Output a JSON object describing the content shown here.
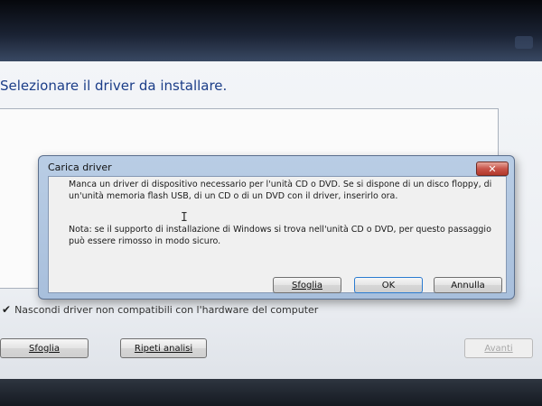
{
  "wizard": {
    "title": "Selezionare il driver da installare.",
    "hide_incompatible_label": "Nascondi driver non compatibili con l'hardware del computer",
    "hide_incompatible_checked": true,
    "buttons": {
      "browse": "Sfoglia",
      "rescan": "Ripeti analisi",
      "next": "Avanti"
    }
  },
  "dialog": {
    "title": "Carica driver",
    "close_glyph": "✕",
    "message": "Manca un driver di dispositivo necessario per l'unità CD o DVD. Se si dispone di un disco floppy, di un'unità memoria flash USB, di un CD o di un DVD con il driver, inserirlo ora.",
    "note": "Nota: se il supporto di installazione di Windows si trova nell'unità CD o DVD, per questo passaggio può essere rimosso in modo sicuro.",
    "buttons": {
      "browse": "Sfoglia",
      "ok": "OK",
      "cancel": "Annulla"
    }
  },
  "colors": {
    "title_blue": "#1b3d88",
    "dialog_frame": "#b9cde5",
    "close_red": "#c8554a"
  },
  "icons": {
    "check": "check-icon",
    "close": "close-icon",
    "text_cursor": "i-beam-cursor-icon"
  }
}
